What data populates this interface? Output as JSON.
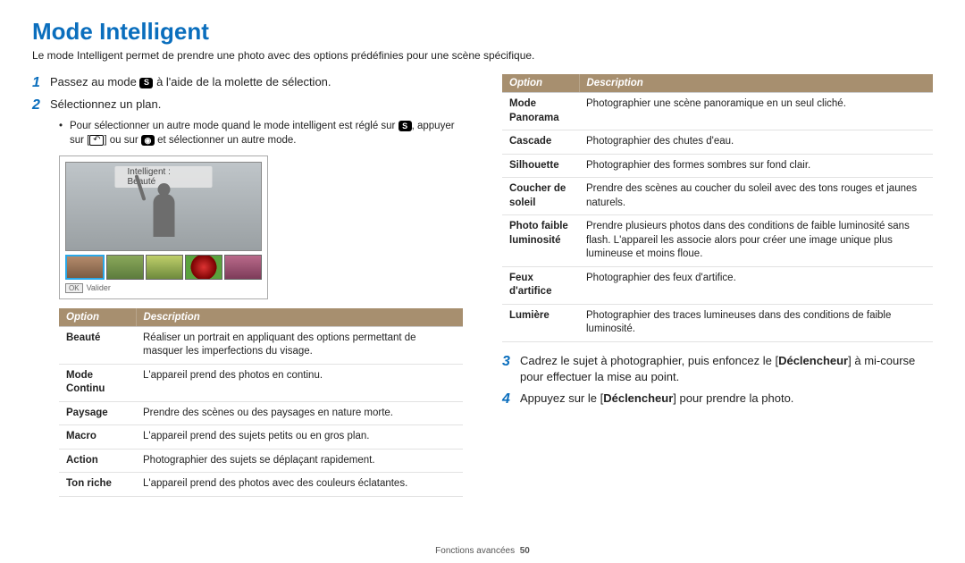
{
  "title": "Mode Intelligent",
  "intro": "Le mode Intelligent permet de prendre une photo avec des options prédéfinies pour une scène spécifique.",
  "steps": {
    "s1_pre": "Passez au mode ",
    "s1_post": " à l'aide de la molette de sélection.",
    "s2": "Sélectionnez un plan.",
    "s2_bullet_pre": "Pour sélectionner un autre mode quand le mode intelligent est réglé sur ",
    "s2_bullet_mid": ", appuyer sur [",
    "s2_bullet_mid2": "] ou sur ",
    "s2_bullet_end": " et sélectionner un autre mode.",
    "s3_pre": "Cadrez le sujet à photographier, puis enfoncez le [",
    "s3_bold": "Déclencheur",
    "s3_post": "] à mi-course pour effectuer la mise au point.",
    "s4_pre": "Appuyez sur le [",
    "s4_bold": "Déclencheur",
    "s4_post": "] pour prendre la photo."
  },
  "preview": {
    "label": "Intelligent : Beauté",
    "ok": "OK",
    "valider": "Valider"
  },
  "headers": {
    "opt": "Option",
    "desc": "Description"
  },
  "left_table": [
    {
      "opt": "Beauté",
      "desc": "Réaliser un portrait en appliquant des options permettant de masquer les imperfections du visage."
    },
    {
      "opt": "Mode Continu",
      "desc": "L'appareil prend des photos en continu."
    },
    {
      "opt": "Paysage",
      "desc": "Prendre des scènes ou des paysages en nature morte."
    },
    {
      "opt": "Macro",
      "desc": "L'appareil prend des sujets petits ou en gros plan."
    },
    {
      "opt": "Action",
      "desc": "Photographier des sujets se déplaçant rapidement."
    },
    {
      "opt": "Ton riche",
      "desc": "L'appareil prend des photos avec des couleurs éclatantes."
    }
  ],
  "right_table": [
    {
      "opt": "Mode Panorama",
      "desc": "Photographier une scène panoramique en un seul cliché."
    },
    {
      "opt": "Cascade",
      "desc": "Photographier des chutes d'eau."
    },
    {
      "opt": "Silhouette",
      "desc": "Photographier des formes sombres sur fond clair."
    },
    {
      "opt": "Coucher de soleil",
      "desc": "Prendre des scènes au coucher du soleil avec des tons rouges et jaunes naturels."
    },
    {
      "opt": "Photo faible luminosité",
      "desc": "Prendre plusieurs photos dans des conditions de faible luminosité sans flash. L'appareil les associe alors pour créer une image unique plus lumineuse et moins floue."
    },
    {
      "opt": "Feux d'artifice",
      "desc": "Photographier des feux d'artifice."
    },
    {
      "opt": "Lumière",
      "desc": "Photographier des traces lumineuses dans des conditions de faible luminosité."
    }
  ],
  "footer": {
    "section": "Fonctions avancées",
    "page": "50"
  },
  "icons": {
    "s": "S",
    "back": "↶",
    "cam": "◉"
  }
}
